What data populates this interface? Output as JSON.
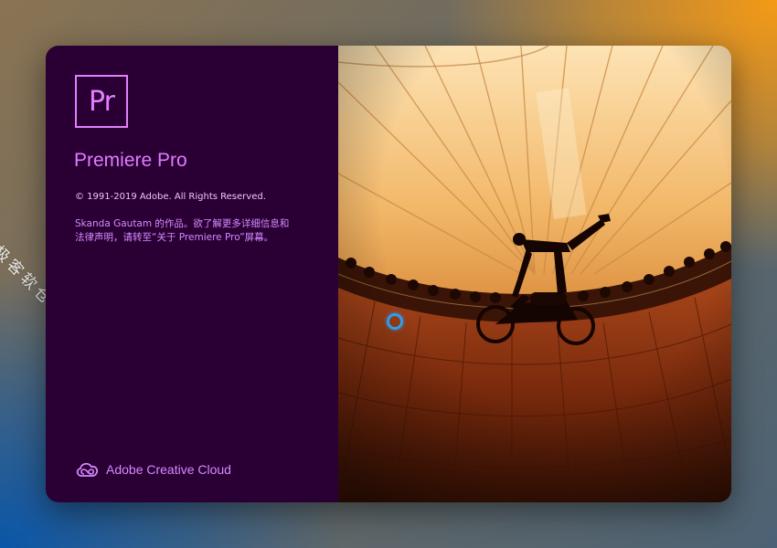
{
  "watermark": {
    "text": "极客软仓"
  },
  "splash": {
    "app_icon_text": "Pr",
    "app_name": "Premiere Pro",
    "copyright": "© 1991-2019 Adobe. All Rights Reserved.",
    "credit_line1": "Skanda  Gautam 的作品。欲了解更多详细信息和",
    "credit_line2": "法律声明，请转至“关于 Premiere Pro”屏幕。",
    "footer_label": "Adobe Creative Cloud",
    "icons": {
      "app": "premiere-pro-icon",
      "footer": "creative-cloud-icon"
    },
    "colors": {
      "panel_bg": "#2a0034",
      "accent": "#e07cff",
      "text": "#d58aff"
    }
  },
  "cursor": {
    "icon": "busy-spinner-icon",
    "color": "#2e9cf0"
  }
}
